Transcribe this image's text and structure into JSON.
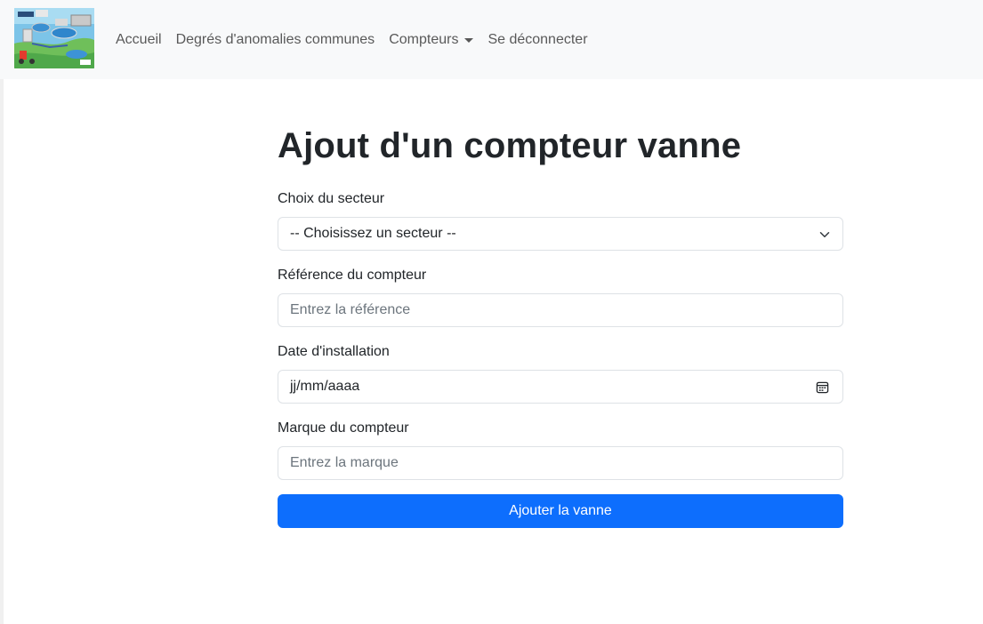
{
  "nav": {
    "links": [
      "Accueil",
      "Degrés d'anomalies communes",
      "Compteurs",
      "Se déconnecter"
    ]
  },
  "page": {
    "title": "Ajout d'un compteur vanne"
  },
  "form": {
    "sector_label": "Choix du secteur",
    "sector_selected": "-- Choisissez un secteur --",
    "reference_label": "Référence du compteur",
    "reference_placeholder": "Entrez la référence",
    "date_label": "Date d'installation",
    "date_placeholder": "jj/mm/aaaa",
    "brand_label": "Marque du compteur",
    "brand_placeholder": "Entrez la marque",
    "submit_label": "Ajouter la vanne"
  },
  "colors": {
    "primary": "#0d6efd",
    "navbar_bg": "#f8f9fa",
    "border": "#dee2e6",
    "text": "#212529",
    "muted": "#6c757d"
  },
  "icons": {
    "logo": "water-network-logo",
    "dropdown": "chevron-down-icon",
    "date": "calendar-icon"
  }
}
